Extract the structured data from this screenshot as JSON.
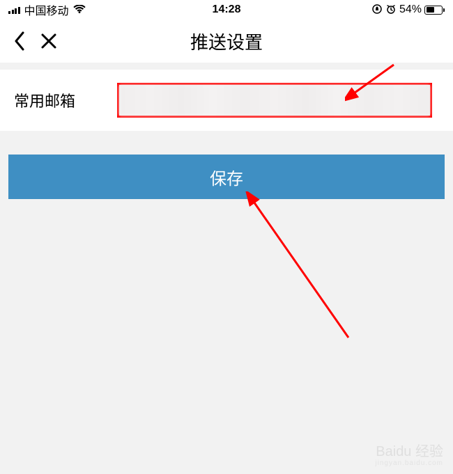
{
  "status_bar": {
    "carrier": "中国移动",
    "time": "14:28",
    "battery_percent": "54%",
    "battery_fill_width": "54%"
  },
  "nav": {
    "title": "推送设置"
  },
  "form": {
    "email_label": "常用邮箱",
    "email_value": ""
  },
  "actions": {
    "save_label": "保存"
  },
  "watermark": {
    "brand": "Baidu 经验",
    "sub": "jingyan.baidu.com"
  }
}
